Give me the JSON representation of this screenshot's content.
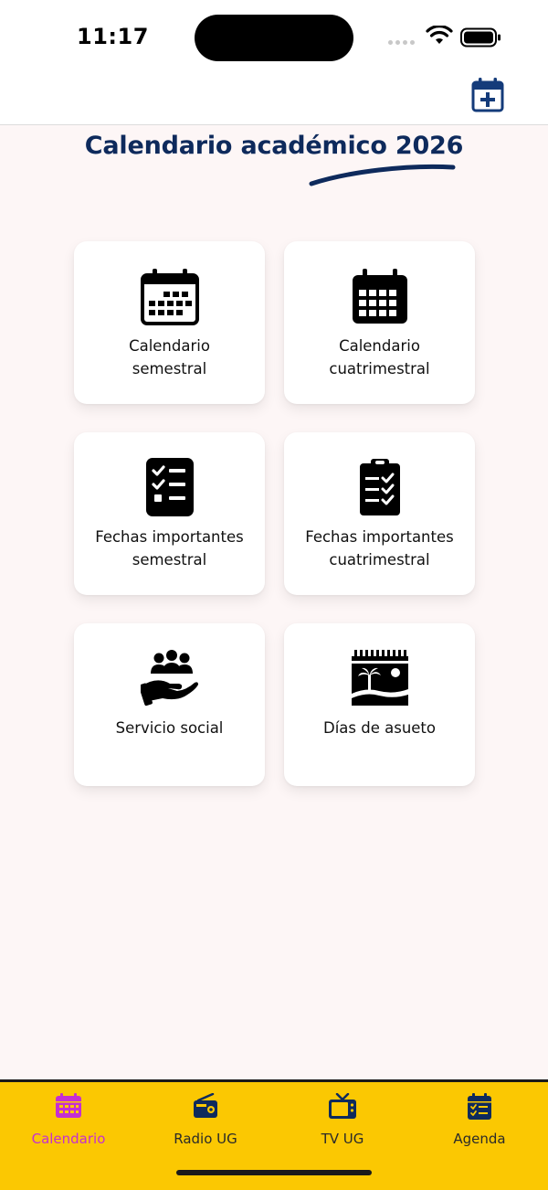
{
  "status_bar": {
    "time": "11:17",
    "icons": [
      "signal-dots",
      "wifi-icon",
      "battery-icon"
    ]
  },
  "header": {
    "action_icon": "calendar-plus-icon"
  },
  "page": {
    "title": "Calendario académico 2026",
    "title_color": "#0e2a5c"
  },
  "cards": [
    {
      "label": "Calendario\nsemestral",
      "icon": "calendar-icon"
    },
    {
      "label": "Calendario\ncuatrimestral",
      "icon": "calendar-grid-icon"
    },
    {
      "label": "Fechas importantes\nsemestral",
      "icon": "checklist-icon"
    },
    {
      "label": "Fechas importantes\ncuatrimestral",
      "icon": "clipboard-check-icon"
    },
    {
      "label": "Servicio social",
      "icon": "community-hand-icon"
    },
    {
      "label": "Días de asueto",
      "icon": "beach-calendar-icon"
    }
  ],
  "bottom_nav": {
    "background": "#fbc802",
    "active_color": "#c52fd2",
    "items": [
      {
        "label": "Calendario",
        "icon": "calendar-icon",
        "active": true
      },
      {
        "label": "Radio UG",
        "icon": "radio-icon",
        "active": false
      },
      {
        "label": "TV UG",
        "icon": "tv-icon",
        "active": false
      },
      {
        "label": "Agenda",
        "icon": "agenda-icon",
        "active": false
      }
    ]
  }
}
